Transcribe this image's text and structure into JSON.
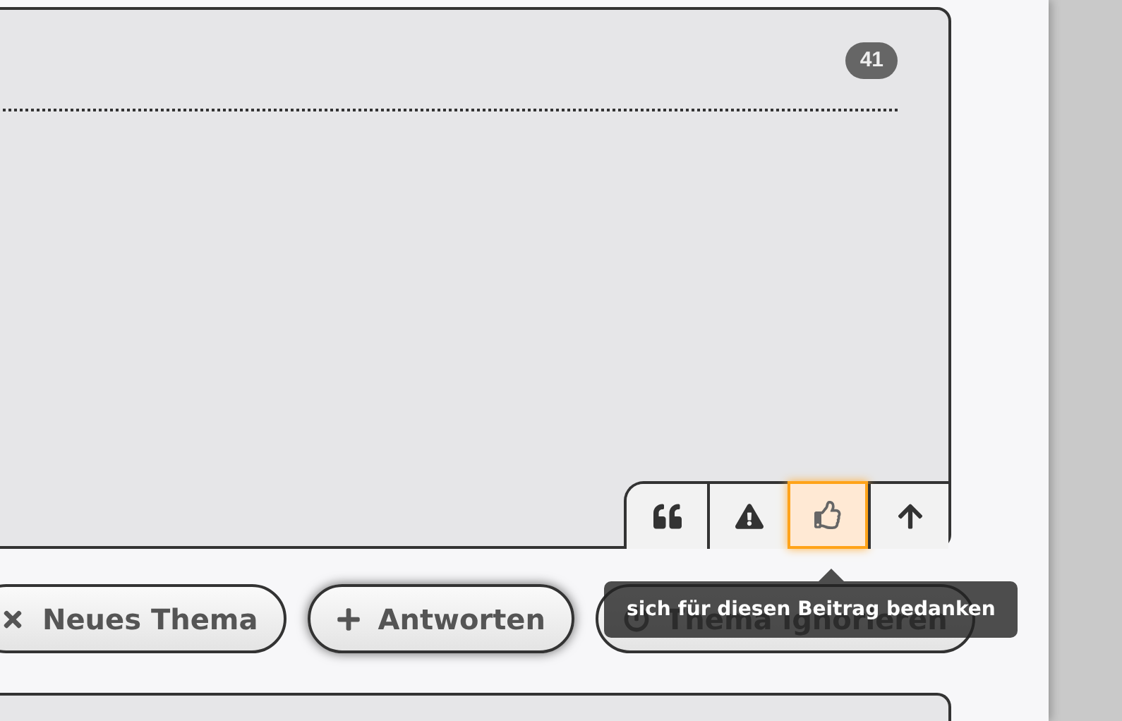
{
  "post": {
    "count": "41",
    "actions": [
      {
        "kind": "quote",
        "selected": false
      },
      {
        "kind": "report",
        "selected": false
      },
      {
        "kind": "thanks",
        "selected": true
      },
      {
        "kind": "top",
        "selected": false
      }
    ]
  },
  "buttons": [
    {
      "kind": "new",
      "label": "Neues Thema",
      "focused": false
    },
    {
      "kind": "reply",
      "label": "Antworten",
      "focused": true
    },
    {
      "kind": "ignore",
      "label": "Thema ignorieren",
      "focused": false
    }
  ],
  "tooltip": {
    "text": "sich für diesen Beitrag bedanken"
  }
}
